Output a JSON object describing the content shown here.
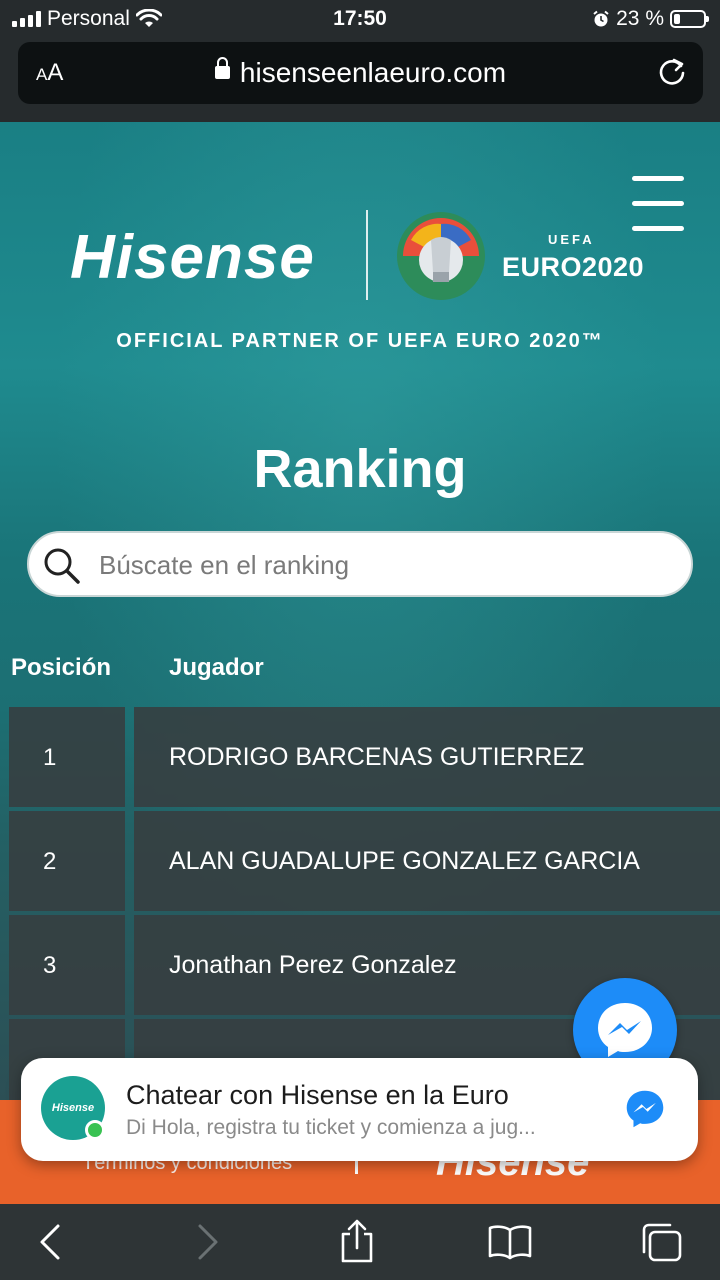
{
  "status_bar": {
    "carrier": "Personal",
    "time": "17:50",
    "battery": "23 %",
    "battery_level": 0.23
  },
  "browser": {
    "text_size_label": "AA",
    "url": "hisenseenlaeuro.com"
  },
  "site": {
    "brand": "Hisense",
    "euro_logo": "EURO2020",
    "uefa_logo": "UEFA",
    "partner_text": "OFFICIAL PARTNER OF UEFA EURO 2020™",
    "ranking_title": "Ranking",
    "search_placeholder": "Búscate en el ranking",
    "columns": {
      "position": "Posición",
      "player": "Jugador"
    },
    "rows": [
      {
        "pos": "1",
        "name": "RODRIGO BARCENAS GUTIERREZ"
      },
      {
        "pos": "2",
        "name": "ALAN GUADALUPE GONZALEZ GARCIA"
      },
      {
        "pos": "3",
        "name": "Jonathan Perez Gonzalez"
      }
    ],
    "footer_terms": "Términos y condiciones",
    "footer_logo": "Hisense"
  },
  "chat": {
    "avatar_text": "Hisense",
    "title": "Chatear con Hisense en la Euro",
    "subtitle": "Di Hola, registra tu ticket y comienza a jug..."
  },
  "colors": {
    "teal": "#1a7f84",
    "orange": "#e8622a",
    "messenger": "#1d8cf8"
  }
}
